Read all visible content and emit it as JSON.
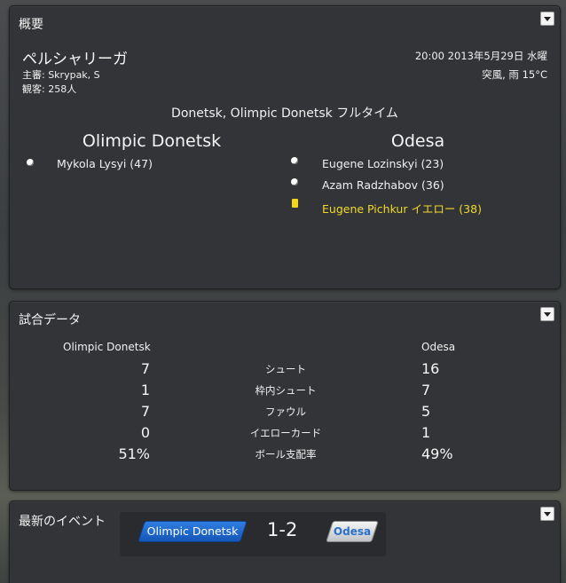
{
  "overview": {
    "title": "概要",
    "competition": "ペルシャリーガ",
    "referee": "主審: Skrypak, S",
    "attendance": "観客: 258人",
    "datetime": "20:00 2013年5月29日 水曜",
    "weather": "突風, 雨 15°C",
    "result": "Donetsk, Olimpic Donetsk フルタイム",
    "home_team": "Olimpic Donetsk",
    "away_team": "Odesa",
    "home_events": [
      {
        "icon": "ball-icon",
        "text": "Mykola Lysyi (47)"
      }
    ],
    "away_events": [
      {
        "icon": "ball-icon",
        "text": "Eugene Lozinskyi (23)"
      },
      {
        "icon": "ball-icon",
        "text": "Azam Radzhabov (36)"
      },
      {
        "icon": "yellow-card-icon",
        "text": "Eugene Pichkur イエロー (38)",
        "color": "#f1d92b"
      }
    ]
  },
  "stats": {
    "title": "試合データ",
    "home_team": "Olimpic Donetsk",
    "away_team": "Odesa",
    "rows": [
      {
        "label": "シュート",
        "home": "7",
        "away": "16"
      },
      {
        "label": "枠内シュート",
        "home": "1",
        "away": "7"
      },
      {
        "label": "ファウル",
        "home": "7",
        "away": "5"
      },
      {
        "label": "イエローカード",
        "home": "0",
        "away": "1"
      },
      {
        "label": "ボール支配率",
        "home": "51%",
        "away": "49%"
      }
    ]
  },
  "latest": {
    "title": "最新のイベント",
    "home_team": "Olimpic Donetsk",
    "away_team": "Odesa",
    "score": "1-2",
    "home_color": "#1f6ad0",
    "away_color": "#e6e6e6"
  }
}
